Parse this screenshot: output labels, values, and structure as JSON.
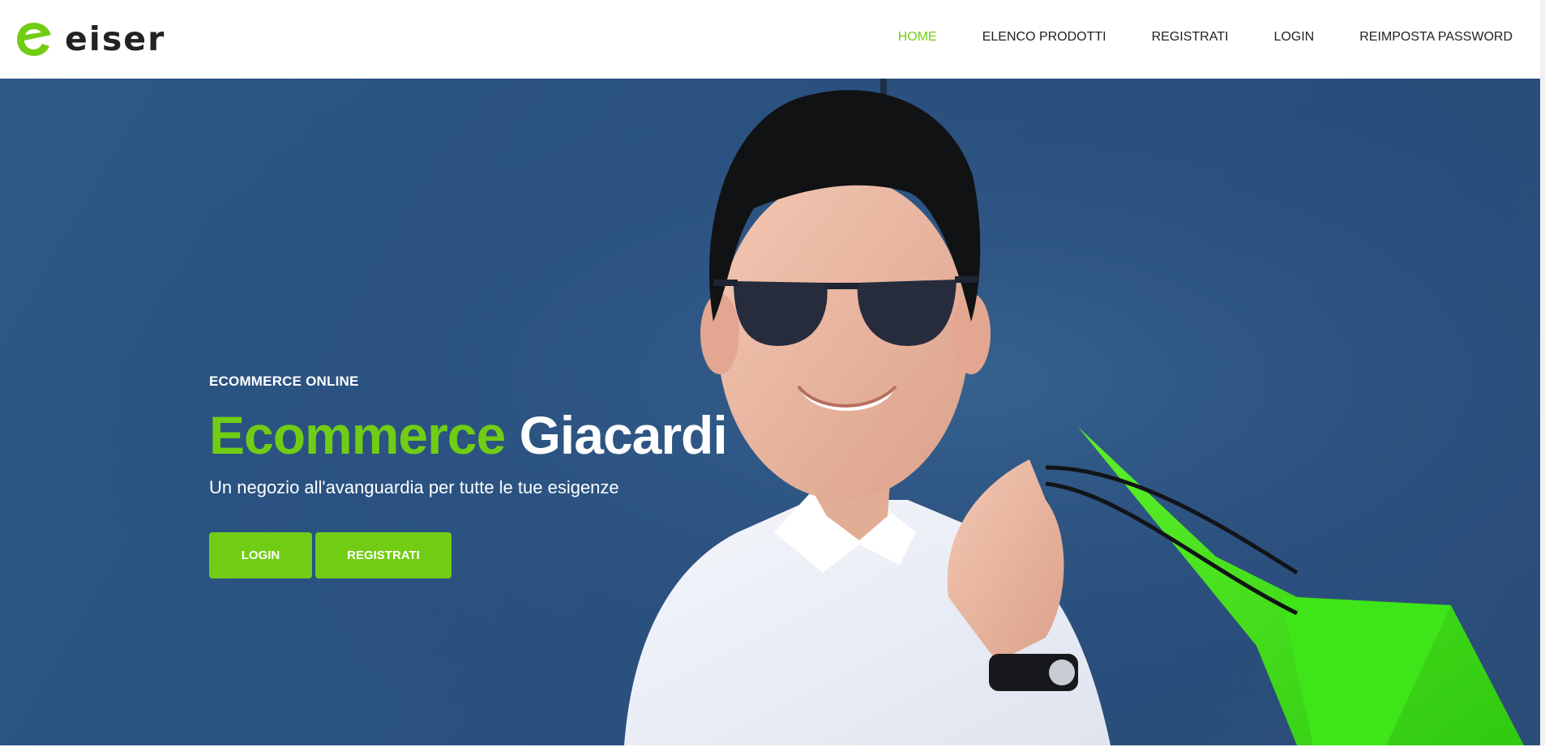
{
  "brand": {
    "name": "eiser",
    "accent_color": "#71cd14",
    "text_color": "#222222"
  },
  "nav": {
    "items": [
      {
        "label": "HOME",
        "active": true
      },
      {
        "label": "ELENCO PRODOTTI",
        "active": false
      },
      {
        "label": "REGISTRATI",
        "active": false
      },
      {
        "label": "LOGIN",
        "active": false
      },
      {
        "label": "REIMPOSTA PASSWORD",
        "active": false
      }
    ]
  },
  "hero": {
    "kicker": "ECOMMERCE ONLINE",
    "title_highlight": "Ecommerce",
    "title_rest": "Giacardi",
    "subtitle": "Un negozio all'avanguardia per tutte le tue esigenze",
    "buttons": {
      "login_label": "LOGIN",
      "register_label": "REGISTRATI"
    },
    "background_color": "#2b5180"
  }
}
